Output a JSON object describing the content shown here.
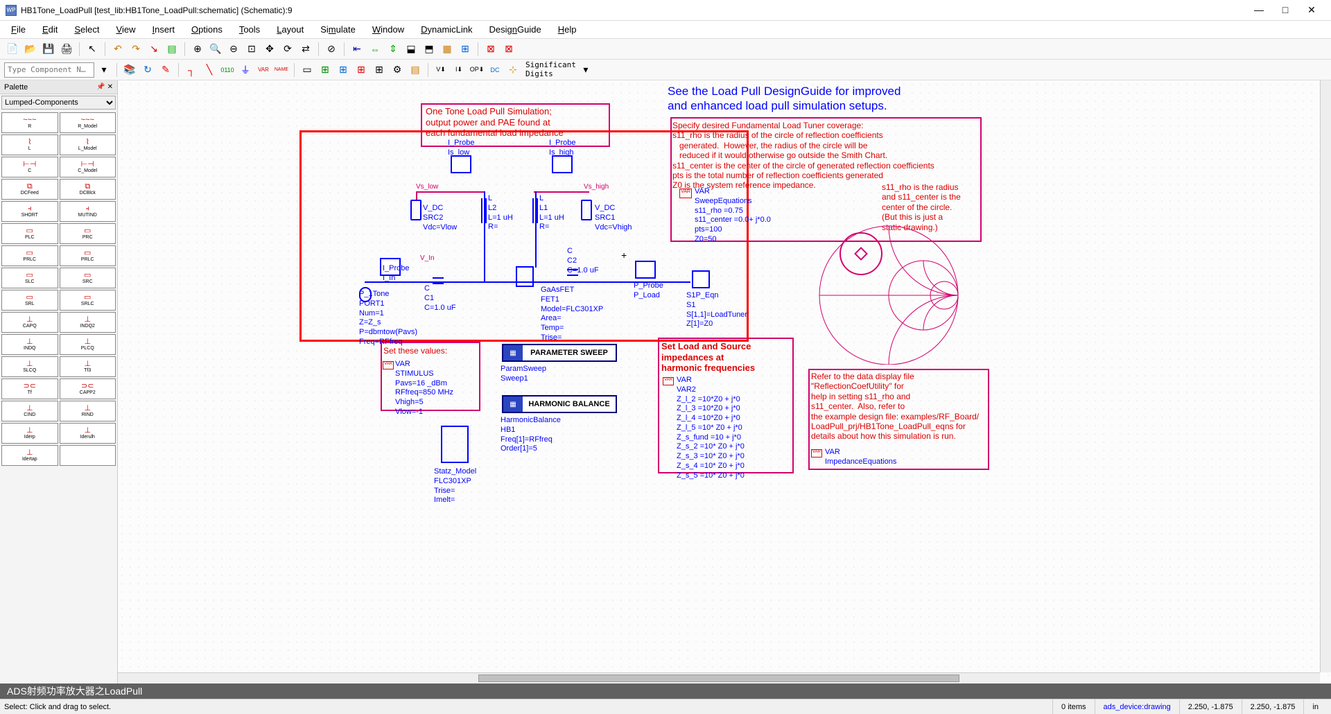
{
  "window": {
    "title": "HB1Tone_LoadPull [test_lib:HB1Tone_LoadPull:schematic] (Schematic):9",
    "app_icon": "WP"
  },
  "menus": [
    "File",
    "Edit",
    "Select",
    "View",
    "Insert",
    "Options",
    "Tools",
    "Layout",
    "Simulate",
    "Window",
    "DynamicLink",
    "DesignGuide",
    "Help"
  ],
  "toolbar2": {
    "comp_placeholder": "Type Component N…",
    "sig_digits": "Significant\nDigits"
  },
  "palette": {
    "title": "Palette",
    "category": "Lumped-Components",
    "items": [
      {
        "sym": "~~~",
        "lbl": "R"
      },
      {
        "sym": "~~~",
        "lbl": "R_Model"
      },
      {
        "sym": "⌇",
        "lbl": "L"
      },
      {
        "sym": "⌇",
        "lbl": "L_Model"
      },
      {
        "sym": "⊢⊣",
        "lbl": "C"
      },
      {
        "sym": "⊢⊣",
        "lbl": "C_Model"
      },
      {
        "sym": "⧉",
        "lbl": "DCFeed"
      },
      {
        "sym": "⧉",
        "lbl": "DCBlck"
      },
      {
        "sym": "⫞",
        "lbl": "SHORT"
      },
      {
        "sym": "⫞",
        "lbl": "MUTIND"
      },
      {
        "sym": "▭",
        "lbl": "PLC"
      },
      {
        "sym": "▭",
        "lbl": "PRC"
      },
      {
        "sym": "▭",
        "lbl": "PRLC"
      },
      {
        "sym": "▭",
        "lbl": "PRLC"
      },
      {
        "sym": "▭",
        "lbl": "SLC"
      },
      {
        "sym": "▭",
        "lbl": "SRC"
      },
      {
        "sym": "▭",
        "lbl": "SRL"
      },
      {
        "sym": "▭",
        "lbl": "SRLC"
      },
      {
        "sym": "⊥",
        "lbl": "CAPQ"
      },
      {
        "sym": "⊥",
        "lbl": "INDQ2"
      },
      {
        "sym": "⊥",
        "lbl": "INDQ"
      },
      {
        "sym": "⊥",
        "lbl": "PLCQ"
      },
      {
        "sym": "⊥",
        "lbl": "SLCQ"
      },
      {
        "sym": "⊥",
        "lbl": "Tf3"
      },
      {
        "sym": "⊃⊂",
        "lbl": "Tf"
      },
      {
        "sym": "⊃⊂",
        "lbl": "CAPP2"
      },
      {
        "sym": "⊥",
        "lbl": "CIND"
      },
      {
        "sym": "⊥",
        "lbl": "RIND"
      },
      {
        "sym": "⊥",
        "lbl": "Iderp"
      },
      {
        "sym": "⊥",
        "lbl": "Iderulh"
      },
      {
        "sym": "⊥",
        "lbl": "Idertap"
      },
      {
        "sym": "",
        "lbl": ""
      }
    ]
  },
  "schematic": {
    "title_note": "One Tone Load Pull Simulation;\noutput power and PAE found at\neach fundamental load impedance",
    "design_guide_head": "See the Load Pull DesignGuide for improved\nand enhanced load pull simulation setups.",
    "tuner_spec": "Specify desired Fundamental Load Tuner coverage:\ns11_rho is the radius of the circle of reflection coefficients\n   generated.  However, the radius of the circle will be\n   reduced if it would otherwise go outside the Smith Chart.\ns11_center is the center of the circle of generated reflection coefficients\npts is the total number of reflection coefficients generated\nZ0 is the system reference impedance.",
    "smith_note": "s11_rho is the radius\nand s11_center is the\ncenter of the circle.\n(But this is just a\nstatic drawing.)",
    "sweep_eq": "VAR\nSweepEquations\ns11_rho =0.75\ns11_center =0.0+ j*0.0\npts=100\nZ0=50",
    "set_values_title": "Set these values:",
    "stimulus": "VAR\nSTIMULUS\nPavs=16 _dBm\nRFfreq=850 MHz\nVhigh=5\nVlow=-1",
    "param_sweep_label": "PARAMETER SWEEP",
    "param_sweep_txt": "ParamSweep\nSweep1",
    "hb_label": "HARMONIC BALANCE",
    "hb_txt": "HarmonicBalance\nHB1\nFreq[1]=RFfreq\nOrder[1]=5",
    "statz": "Statz_Model\nFLC301XP\nTrise=\nImelt=",
    "set_load_title": "Set Load and Source\nimpedances at\nharmonic frequencies",
    "var2": "VAR\nVAR2\nZ_l_2 =10*Z0 + j*0\nZ_l_3 =10*Z0 + j*0\nZ_l_4 =10*Z0 + j*0\nZ_l_5 =10* Z0 + j*0\nZ_s_fund =10 + j*0\nZ_s_2 =10* Z0 + j*0\nZ_s_3 =10* Z0 + j*0\nZ_s_4 =10* Z0 + j*0\nZ_s_5 =10* Z0 + j*0",
    "refer_note": "Refer to the data display file\n\"ReflectionCoefUtility\" for\nhelp in setting s11_rho and\ns11_center.  Also, refer to\nthe example design file: examples/RF_Board/\nLoadPull_prj/HB1Tone_LoadPull_eqns for\ndetails about how this simulation is run.",
    "imp_eq": "VAR\nImpedanceEquations",
    "iprobe_low": "I_Probe\nIs_low",
    "iprobe_high": "I_Probe\nIs_high",
    "vdc_left": "V_DC\nSRC2\nVdc=Vlow",
    "vdc_right": "V_DC\nSRC1\nVdc=Vhigh",
    "l2": "L\nL2\nL=1 uH\nR=",
    "l1": "L\nL1\nL=1 uH\nR=",
    "vs_low": "Vs_low",
    "vs_high": "Vs_high",
    "v_in": "V_In",
    "iprobe_in": "I_Probe\nI_In",
    "port1": "P_1Tone\nPORT1\nNum=1\nZ=Z_s\nP=dbmtow(Pavs)\nFreq=RFfreq",
    "c1": "C\nC1\nC=1.0 uF",
    "c2": "C\nC2\nC=1.0 uF",
    "fet": "GaAsFET\nFET1\nModel=FLC301XP\nArea=\nTemp=\nTrise=",
    "pprobe": "P_Probe\nP_Load",
    "s1p": "S1P_Eqn\nS1\nS[1,1]=LoadTuner\nZ[1]=Z0"
  },
  "caption": "ADS射频功率放大器之LoadPull",
  "status": {
    "hint": "Select: Click and drag to select.",
    "items": "0 items",
    "layer": "ads_device:drawing",
    "coord1": "2.250, -1.875",
    "coord2": "2.250, -1.875",
    "unit": "in"
  }
}
